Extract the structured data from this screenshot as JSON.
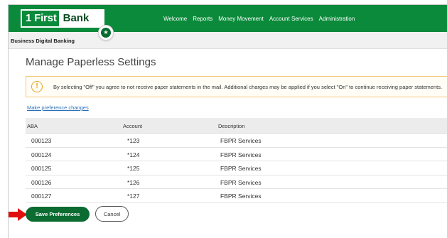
{
  "brand": {
    "logo_left": "1 First",
    "logo_right": "Bank",
    "accent": "#0a8a3a"
  },
  "nav": [
    "Welcome",
    "Reports",
    "Money Movement",
    "Account Services",
    "Administration"
  ],
  "subbar": {
    "label": "Business Digital Banking",
    "badge_icon": "star-icon"
  },
  "page": {
    "title": "Manage Paperless Settings"
  },
  "alert": {
    "icon": "warning-icon",
    "text": "By selecting \"Off\" you agree to not receive paper statements in the mail. Additional charges may be applied if you select \"On\" to continue receiving paper statements."
  },
  "link": {
    "label": "Make preference changes"
  },
  "table": {
    "headers": [
      "ABA",
      "Account",
      "Description"
    ],
    "rows": [
      [
        "000123",
        "*123",
        "FBPR Services"
      ],
      [
        "000124",
        "*124",
        "FBPR Services"
      ],
      [
        "000125",
        "*125",
        "FBPR Services"
      ],
      [
        "000126",
        "*126",
        "FBPR Services"
      ],
      [
        "000127",
        "*127",
        "FBPR Services"
      ]
    ]
  },
  "actions": {
    "save_label": "Save Preferences",
    "cancel_label": "Cancel",
    "pointer_icon": "red-arrow-icon"
  }
}
